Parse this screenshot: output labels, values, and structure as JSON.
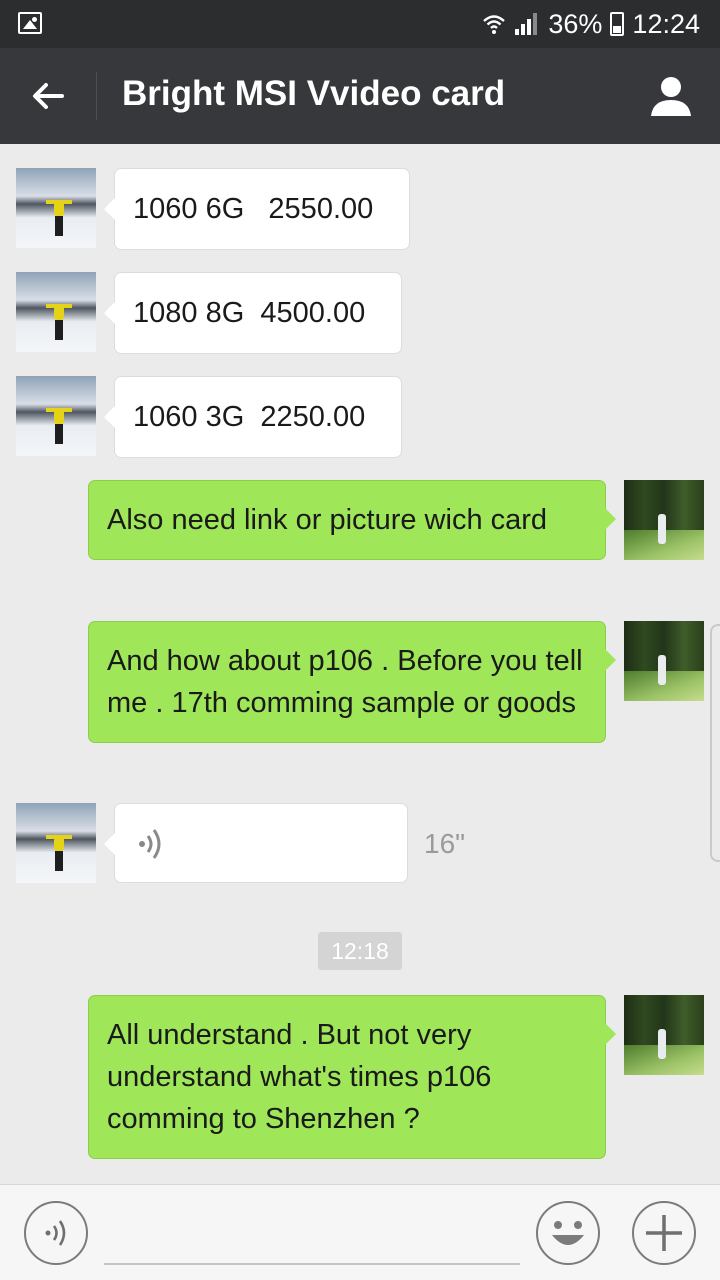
{
  "status_bar": {
    "battery": "36%",
    "time": "12:24"
  },
  "header": {
    "title": "Bright MSI Vvideo card"
  },
  "messages": [
    {
      "from": "contact",
      "text": "1060 6G   2550.00"
    },
    {
      "from": "contact",
      "text": "1080 8G  4500.00"
    },
    {
      "from": "contact",
      "text": "1060 3G  2250.00"
    },
    {
      "from": "me",
      "text": "Also need link or picture wich card"
    },
    {
      "from": "me",
      "text": "And how about p106 . Before you tell me . 17th comming sample or goods"
    },
    {
      "from": "contact",
      "type": "voice",
      "duration": "16\""
    },
    {
      "type": "timestamp",
      "text": "12:18"
    },
    {
      "from": "me",
      "text": "All understand . But not very understand what's times p106 comming to Shenzhen ?"
    }
  ],
  "colors": {
    "outgoing_bubble": "#9fe658",
    "incoming_bubble": "#ffffff",
    "app_bar": "#36383b",
    "status_bar": "#2c2d2f"
  },
  "icons": [
    "gallery-icon",
    "wifi-icon",
    "signal-icon",
    "battery-icon",
    "back-arrow-icon",
    "person-icon",
    "voice-wave-icon",
    "emoji-icon",
    "plus-icon"
  ]
}
